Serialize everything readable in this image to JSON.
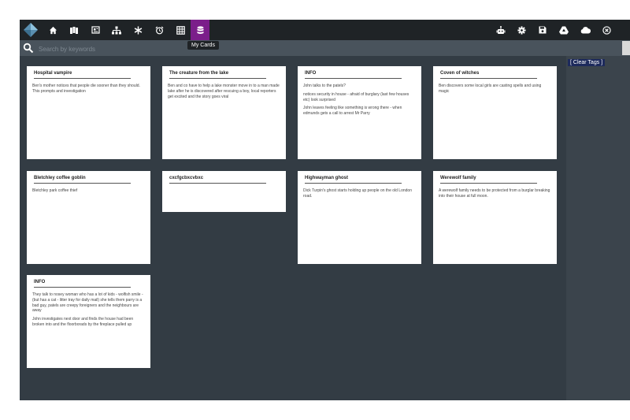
{
  "toolbar": {
    "tooltip": "My Cards",
    "accent": "#7b1e8a",
    "left_icons": [
      "home-icon",
      "map-icon",
      "newspaper-icon",
      "sitemap-icon",
      "asterisk-icon",
      "alarm-clock-icon",
      "table-grid-icon",
      "database-icon"
    ],
    "right_icons": [
      "robot-icon",
      "gear-icon",
      "save-icon",
      "google-drive-icon",
      "cloud-icon",
      "close-icon"
    ]
  },
  "search": {
    "placeholder": "Search by keywords"
  },
  "sidebar": {
    "clear_tags": "[ Clear Tags ]"
  },
  "cards": [
    {
      "title": "Hospital vampire",
      "paragraphs": [
        "Ben's mother notices that people die sooner than they should. This prompts and investigation"
      ]
    },
    {
      "title": "The creature from the lake",
      "paragraphs": [
        "Ben and co have to help a lake monster move in to a man made lake after he is discovered after rescuing a boy, local reporters get excited and the story goes viral"
      ]
    },
    {
      "title": "INFO",
      "paragraphs": [
        "John talks to the patels?",
        "notices security in house - afraid of burglary (last few houses etc) look surprised",
        "John leaves feeling like something is wrong there - when edmunds gets a call to arrest Mr Parry"
      ]
    },
    {
      "title": "Coven of witches",
      "paragraphs": [
        "Ben discovers some local girls are casting spells and using magic"
      ]
    },
    {
      "title": "Bletchley coffee goblin",
      "paragraphs": [
        "Bletchley park coffee thief"
      ]
    },
    {
      "title": "cxcfgcbxcvbxc",
      "paragraphs": []
    },
    {
      "title": "Highwayman ghost",
      "paragraphs": [
        "Dick Turpin's ghost starts holding up people on the old London road."
      ]
    },
    {
      "title": "Werewolf family",
      "paragraphs": [
        "A werewolf family needs to be protected from a burglar breaking into their house at full moon."
      ]
    },
    {
      "title": "INFO",
      "paragraphs": [
        "They talk to nosey woman who has a lot of kids - wolfish smile - (but has a cat - litter tray for daily mail) she tells them parry is a bad guy, patels are creepy foreigners and the neighbours are away",
        "John investigates next door and finds the house had been broken into and the floorborads by the fireplace pulled up"
      ]
    }
  ]
}
